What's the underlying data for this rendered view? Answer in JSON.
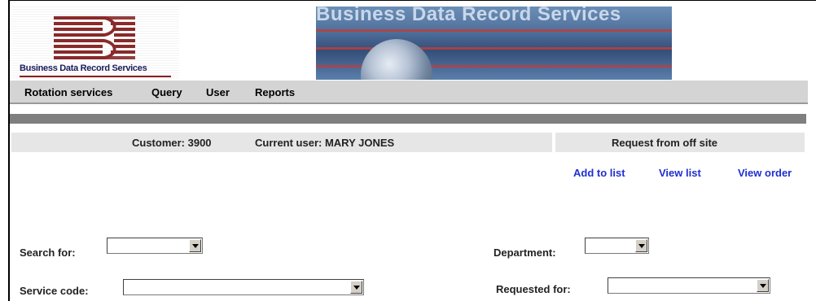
{
  "logo": {
    "text": "Business Data Record Services",
    "icon": "bdr-logo-mark"
  },
  "banner": {
    "title": "Business Data Record Services",
    "icon": "globe-banner-image"
  },
  "menu": {
    "items": [
      {
        "label": "Rotation services"
      },
      {
        "label": "Query"
      },
      {
        "label": "User"
      },
      {
        "label": "Reports"
      }
    ]
  },
  "info": {
    "customer": "Customer: 3900",
    "current_user": "Current user: MARY JONES",
    "page_title": "Request from off site"
  },
  "links": {
    "add_to_list": "Add to list",
    "view_list": "View list",
    "view_order": "View order"
  },
  "form": {
    "search_for": {
      "label": "Search for:",
      "value": ""
    },
    "department": {
      "label": "Department:",
      "value": ""
    },
    "service_code": {
      "label": "Service code:",
      "value": ""
    },
    "requested_for": {
      "label": "Requested for:",
      "value": ""
    }
  },
  "colors": {
    "link": "#1f2fd0",
    "menubar": "#d4d4d4",
    "info_bar": "#e6e6e6",
    "divider_band": "#7f7f7f",
    "logo_red": "#8a2020"
  }
}
